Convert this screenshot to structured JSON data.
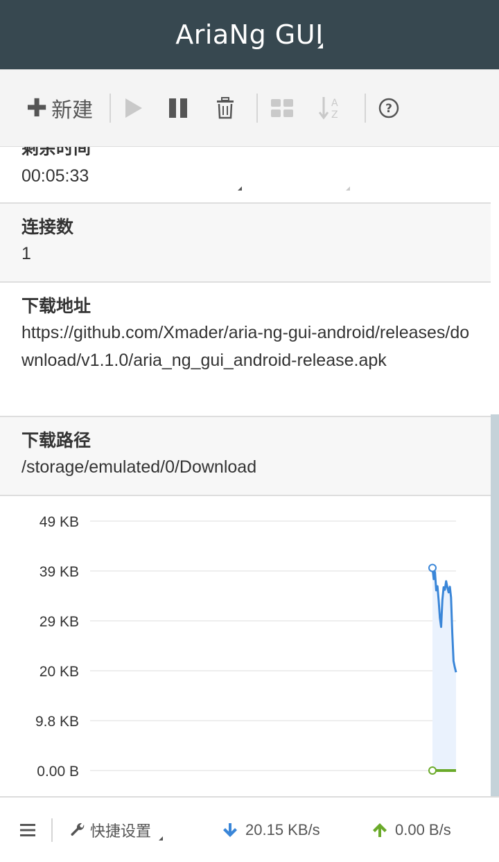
{
  "header": {
    "title": "AriaNg GUI"
  },
  "toolbar": {
    "new_label": "新建"
  },
  "details": [
    {
      "label": "剩余时间",
      "value": "00:05:33"
    },
    {
      "label": "连接数",
      "value": "1"
    },
    {
      "label": "下载地址",
      "value": "https://github.com/Xmader/aria-ng-gui-android/releases/download/v1.1.0/aria_ng_gui_android-release.apk"
    },
    {
      "label": "下载路径",
      "value": "/storage/emulated/0/Download"
    }
  ],
  "chart_data": {
    "type": "line",
    "title": "",
    "xlabel": "",
    "ylabel": "",
    "y_ticks": [
      "49 KB",
      "39 KB",
      "29 KB",
      "20 KB",
      "9.8 KB",
      "0.00 B"
    ],
    "ylim_kb": [
      0,
      49
    ],
    "grid": true,
    "legend": "none",
    "series": [
      {
        "color": "#3a86d8",
        "fill": "#eaf2fd",
        "values_kb": [
          39.8,
          37.6,
          39.0,
          35.4,
          36.2,
          33.5,
          30.0,
          28.2,
          33.5,
          36.0,
          35.5,
          37.2,
          36.0,
          35.0,
          36.1,
          34.0,
          27.0,
          21.5,
          20.3,
          19.3
        ]
      },
      {
        "color": "#6aaa2a",
        "values_kb": [
          0,
          0,
          0,
          0,
          0,
          0,
          0,
          0,
          0,
          0,
          0,
          0,
          0,
          0,
          0,
          0,
          0,
          0,
          0,
          0
        ]
      }
    ]
  },
  "footer": {
    "quick_settings_label": "快捷设置",
    "download_speed": "20.15 KB/s",
    "upload_speed": "0.00 B/s"
  },
  "colors": {
    "header_bg": "#374850",
    "download_arrow": "#3a86d8",
    "upload_arrow": "#6aaa2a"
  }
}
